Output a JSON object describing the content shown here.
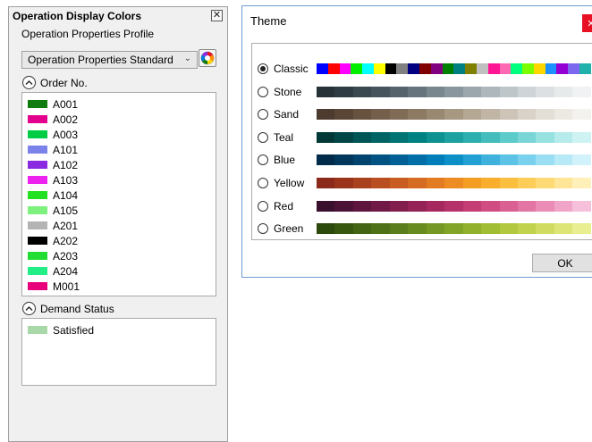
{
  "panel": {
    "title": "Operation Display Colors",
    "close_glyph": "✕",
    "profile_label": "Operation Properties Profile",
    "profile_value": "Operation Properties Standard",
    "order_section": {
      "label": "Order No.",
      "items": [
        {
          "label": "A001",
          "color": "#107c10"
        },
        {
          "label": "A002",
          "color": "#e3008c"
        },
        {
          "label": "A003",
          "color": "#00cc44"
        },
        {
          "label": "A101",
          "color": "#7b83eb"
        },
        {
          "label": "A102",
          "color": "#8a2be2"
        },
        {
          "label": "A103",
          "color": "#ee22ee"
        },
        {
          "label": "A104",
          "color": "#22e022"
        },
        {
          "label": "A105",
          "color": "#7ef07e"
        },
        {
          "label": "A201",
          "color": "#b4b4b4"
        },
        {
          "label": "A202",
          "color": "#000000"
        },
        {
          "label": "A203",
          "color": "#22dd33"
        },
        {
          "label": "A204",
          "color": "#22ee88"
        },
        {
          "label": "M001",
          "color": "#e8007a"
        }
      ]
    },
    "demand_section": {
      "label": "Demand Status",
      "items": [
        {
          "label": "Satisfied",
          "color": "#a8d8a8"
        }
      ]
    }
  },
  "dialog": {
    "title": "Theme",
    "close_glyph": "✕",
    "ok_label": "OK",
    "selected_theme": "Classic",
    "themes": [
      {
        "name": "Classic",
        "colors": [
          "#0000ff",
          "#ff0000",
          "#ff00ff",
          "#00ee00",
          "#00ffff",
          "#ffff00",
          "#000000",
          "#808080",
          "#000080",
          "#800000",
          "#800080",
          "#008000",
          "#008080",
          "#808000",
          "#c0c0c0",
          "#ff1493",
          "#ff69b4",
          "#00ff7f",
          "#7cfc00",
          "#ffd700",
          "#1e90ff",
          "#9400d3",
          "#7b68ee",
          "#20b2aa"
        ]
      },
      {
        "name": "Stone",
        "colors": [
          "#263238",
          "#2f3c43",
          "#3a4850",
          "#46555d",
          "#55646c",
          "#66757d",
          "#78868d",
          "#8a969d",
          "#9ca7ad",
          "#aeb7bc",
          "#bfc6ca",
          "#ced4d7",
          "#dce0e2",
          "#e7eaeb",
          "#f0f2f3"
        ]
      },
      {
        "name": "Sand",
        "colors": [
          "#4e3b30",
          "#5a4636",
          "#66523f",
          "#735f4b",
          "#806c56",
          "#8d7a63",
          "#9a8972",
          "#a79882",
          "#b4a793",
          "#c1b6a5",
          "#cdc4b7",
          "#d9d2c8",
          "#e3ded6",
          "#ece8e2",
          "#f4f2ee"
        ]
      },
      {
        "name": "Teal",
        "colors": [
          "#003838",
          "#004646",
          "#005555",
          "#006464",
          "#007373",
          "#008282",
          "#0d9191",
          "#1ca0a0",
          "#2eafaf",
          "#45bdbd",
          "#5ecbcb",
          "#7ad6d6",
          "#98e1e1",
          "#b5ebeb",
          "#cff3f3"
        ]
      },
      {
        "name": "Blue",
        "colors": [
          "#002b4a",
          "#00375c",
          "#00446f",
          "#005282",
          "#006095",
          "#006fa8",
          "#007eb9",
          "#0d8fc7",
          "#22a0d3",
          "#3eb1dd",
          "#5cc2e6",
          "#7ad1ed",
          "#99def3",
          "#b7e9f7",
          "#d2f2fb"
        ]
      },
      {
        "name": "Yellow",
        "colors": [
          "#8b2a1a",
          "#9a351c",
          "#aa411e",
          "#b94e20",
          "#c85c21",
          "#d66b22",
          "#e27b22",
          "#ec8c22",
          "#f39d23",
          "#f8ae2c",
          "#fbbf3f",
          "#fdcd58",
          "#feda76",
          "#fee597",
          "#ffefb8"
        ]
      },
      {
        "name": "Red",
        "colors": [
          "#3a0f2e",
          "#4c1236",
          "#5e153e",
          "#701946",
          "#821d4e",
          "#942256",
          "#a5285f",
          "#b53169",
          "#c43d74",
          "#d04d81",
          "#da6092",
          "#e375a4",
          "#ea8cb6",
          "#f0a5c8",
          "#f6c0da"
        ]
      },
      {
        "name": "Green",
        "colors": [
          "#2c4a0c",
          "#37570f",
          "#426413",
          "#4e7117",
          "#5a7e1b",
          "#678b1f",
          "#749823",
          "#82a527",
          "#91b12c",
          "#a1bd34",
          "#b1c83f",
          "#c1d24e",
          "#d0dc61",
          "#dde577",
          "#e9ee90"
        ]
      }
    ]
  },
  "icons": {
    "collapse": "chevron-up-icon",
    "palette": "color-palette-icon",
    "dropdown": "chevron-down-icon"
  }
}
